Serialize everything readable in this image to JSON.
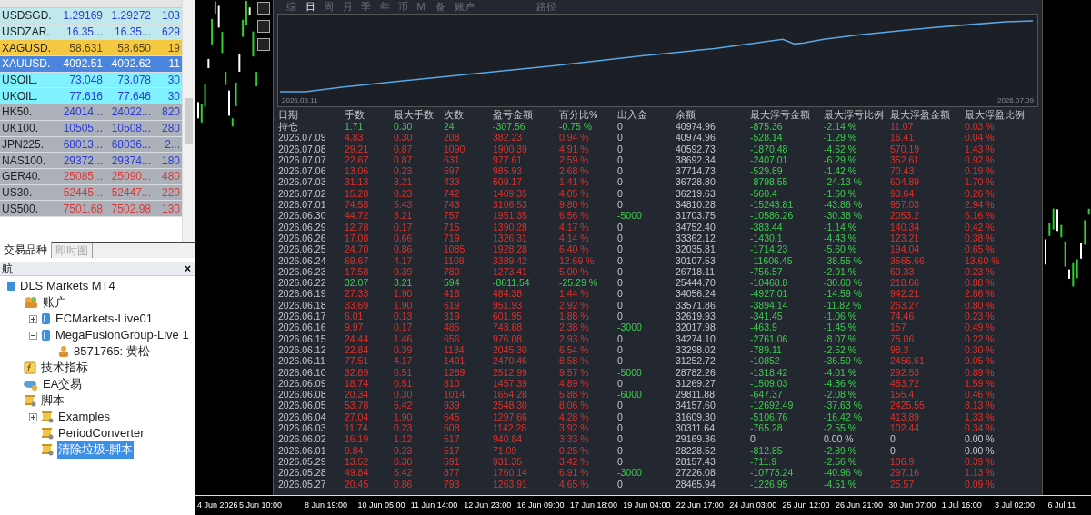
{
  "market_watch": {
    "rows": [
      {
        "symbol": "USDSGD.",
        "bid": "1.29169",
        "ask": "1.29272",
        "spread": "103",
        "color": "#bfe9ec",
        "kind": "up",
        "selected": false
      },
      {
        "symbol": "USDZAR.",
        "bid": "16.35...",
        "ask": "16.35...",
        "spread": "629",
        "color": "#bfe9ec",
        "kind": "up",
        "selected": false
      },
      {
        "symbol": "XAGUSD.",
        "bid": "58.631",
        "ask": "58.650",
        "spread": "19",
        "color": "#f5c842",
        "kind": "flat",
        "selected": false
      },
      {
        "symbol": "XAUUSD.",
        "bid": "4092.51",
        "ask": "4092.62",
        "spread": "11",
        "color": "#4a86e0",
        "kind": "up",
        "selected": true
      },
      {
        "symbol": "USOIL.",
        "bid": "73.048",
        "ask": "73.078",
        "spread": "30",
        "color": "#80f2ff",
        "kind": "up",
        "selected": false
      },
      {
        "symbol": "UKOIL.",
        "bid": "77.616",
        "ask": "77.646",
        "spread": "30",
        "color": "#80f2ff",
        "kind": "up",
        "selected": false
      },
      {
        "symbol": "HK50.",
        "bid": "24014...",
        "ask": "24022...",
        "spread": "820",
        "color": "#acb1b9",
        "kind": "up",
        "selected": false
      },
      {
        "symbol": "UK100.",
        "bid": "10505...",
        "ask": "10508...",
        "spread": "280",
        "color": "#acb1b9",
        "kind": "up",
        "selected": false
      },
      {
        "symbol": "JPN225.",
        "bid": "68013...",
        "ask": "68036...",
        "spread": "2...",
        "color": "#acb1b9",
        "kind": "up",
        "selected": false
      },
      {
        "symbol": "NAS100.",
        "bid": "29372...",
        "ask": "29374...",
        "spread": "180",
        "color": "#acb1b9",
        "kind": "up",
        "selected": false
      },
      {
        "symbol": "GER40.",
        "bid": "25085...",
        "ask": "25090...",
        "spread": "480",
        "color": "#acb1b9",
        "kind": "down",
        "selected": false
      },
      {
        "symbol": "US30.",
        "bid": "52445...",
        "ask": "52447...",
        "spread": "220",
        "color": "#acb1b9",
        "kind": "down",
        "selected": false
      },
      {
        "symbol": "US500.",
        "bid": "7501.68",
        "ask": "7502.98",
        "spread": "130",
        "color": "#acb1b9",
        "kind": "down",
        "selected": false
      }
    ],
    "tabs": [
      {
        "label": "交易品种",
        "selected": true
      },
      {
        "label": "即时图",
        "selected": false
      }
    ]
  },
  "navigator": {
    "title": "航",
    "close": "×",
    "tree": [
      {
        "label": "DLS Markets MT4",
        "kind": "root",
        "selected": false,
        "children": [
          {
            "label": "账户",
            "kind": "accounts",
            "selected": false,
            "children": [
              {
                "label": "ECMarkets-Live01",
                "kind": "server",
                "selected": false,
                "expanded": false
              },
              {
                "label": "MegaFusionGroup-Live 1",
                "kind": "server",
                "selected": false,
                "expanded": true,
                "children": [
                  {
                    "label": "8571765: 黄松",
                    "kind": "user",
                    "selected": false
                  }
                ]
              }
            ]
          },
          {
            "label": "技术指标",
            "kind": "indicators",
            "selected": false
          },
          {
            "label": "EA交易",
            "kind": "experts",
            "selected": false
          },
          {
            "label": "脚本",
            "kind": "scripts",
            "selected": false,
            "children": [
              {
                "label": "Examples",
                "kind": "scripts",
                "selected": false,
                "expanded": false
              },
              {
                "label": "PeriodConverter",
                "kind": "scripts",
                "selected": false
              },
              {
                "label": "清除垃圾-脚本",
                "kind": "scripts",
                "selected": true
              }
            ]
          }
        ]
      }
    ]
  },
  "report": {
    "tabs": [
      {
        "label": "综",
        "selected": false
      },
      {
        "label": "日",
        "selected": true
      },
      {
        "label": "周",
        "selected": false
      },
      {
        "label": "月",
        "selected": false
      },
      {
        "label": "季",
        "selected": false
      },
      {
        "label": "年",
        "selected": false
      },
      {
        "label": "币",
        "selected": false
      },
      {
        "label": "M",
        "selected": false
      },
      {
        "label": "备",
        "selected": false
      },
      {
        "label": "账户",
        "selected": false
      },
      {
        "label": "路径",
        "selected": false
      }
    ],
    "equity_chart": {
      "start_label": "2026.05.11",
      "end_label": "2026.07.09"
    },
    "columns": [
      "日期",
      "手数",
      "最大手数",
      "次数",
      "盈亏金额",
      "百分比%",
      "出入金",
      "余额",
      "最大浮亏金额",
      "最大浮亏比例",
      "最大浮盈金额",
      "最大浮盈比例"
    ],
    "rows": [
      {
        "cells": [
          "持仓",
          "1.71",
          "0.30",
          "24",
          "-307.56",
          "-0.75 %",
          "0",
          "40974.96",
          "-875.36",
          "-2.14 %",
          "11.07",
          "0.03 %"
        ],
        "loss": true,
        "cash_moved": false,
        "drawdown": true,
        "float_gain": true
      },
      {
        "cells": [
          "2026.07.09",
          "4.83",
          "0.30",
          "208",
          "382.23",
          "0.94 %",
          "0",
          "40974.96",
          "-528.14",
          "-1.29 %",
          "16.41",
          "0.04 %"
        ],
        "loss": false,
        "cash_moved": false,
        "drawdown": true,
        "float_gain": true
      },
      {
        "cells": [
          "2026.07.08",
          "29.21",
          "0.87",
          "1090",
          "1900.39",
          "4.91 %",
          "0",
          "40592.73",
          "-1870.48",
          "-4.62 %",
          "570.19",
          "1.43 %"
        ],
        "loss": false,
        "cash_moved": false,
        "drawdown": true,
        "float_gain": true
      },
      {
        "cells": [
          "2026.07.07",
          "22.67",
          "0.87",
          "631",
          "977.61",
          "2.59 %",
          "0",
          "38692.34",
          "-2407.01",
          "-6.29 %",
          "352.61",
          "0.92 %"
        ],
        "loss": false,
        "cash_moved": false,
        "drawdown": true,
        "float_gain": true
      },
      {
        "cells": [
          "2026.07.06",
          "13.06",
          "0.23",
          "597",
          "985.93",
          "2.68 %",
          "0",
          "37714.73",
          "-529.89",
          "-1.42 %",
          "70.43",
          "0.19 %"
        ],
        "loss": false,
        "cash_moved": false,
        "drawdown": true,
        "float_gain": true
      },
      {
        "cells": [
          "2026.07.03",
          "31.13",
          "3.21",
          "433",
          "509.17",
          "1.41 %",
          "0",
          "36728.80",
          "-8798.55",
          "-24.13 %",
          "604.89",
          "1.70 %"
        ],
        "loss": false,
        "cash_moved": false,
        "drawdown": true,
        "float_gain": true
      },
      {
        "cells": [
          "2026.07.02",
          "15.28",
          "0.23",
          "742",
          "1409.35",
          "4.05 %",
          "0",
          "36219.63",
          "-560.4",
          "-1.60 %",
          "93.64",
          "0.26 %"
        ],
        "loss": false,
        "cash_moved": false,
        "drawdown": true,
        "float_gain": true
      },
      {
        "cells": [
          "2026.07.01",
          "74.58",
          "5.43",
          "743",
          "3106.53",
          "9.80 %",
          "0",
          "34810.28",
          "-15243.81",
          "-43.86 %",
          "957.03",
          "2.94 %"
        ],
        "loss": false,
        "cash_moved": false,
        "drawdown": true,
        "float_gain": true
      },
      {
        "cells": [
          "2026.06.30",
          "44.72",
          "3.21",
          "757",
          "1951.35",
          "6.56 %",
          "-5000",
          "31703.75",
          "-10586.26",
          "-30.38 %",
          "2053.2",
          "6.16 %"
        ],
        "loss": false,
        "cash_moved": true,
        "drawdown": true,
        "float_gain": true
      },
      {
        "cells": [
          "2026.06.29",
          "12.78",
          "0.17",
          "715",
          "1390.28",
          "4.17 %",
          "0",
          "34752.40",
          "-383.44",
          "-1.14 %",
          "140.34",
          "0.42 %"
        ],
        "loss": false,
        "cash_moved": false,
        "drawdown": true,
        "float_gain": true
      },
      {
        "cells": [
          "2026.06.26",
          "17.08",
          "0.66",
          "719",
          "1326.31",
          "4.14 %",
          "0",
          "33362.12",
          "-1430.1",
          "-4.43 %",
          "123.21",
          "0.38 %"
        ],
        "loss": false,
        "cash_moved": false,
        "drawdown": true,
        "float_gain": true
      },
      {
        "cells": [
          "2026.06.25",
          "24.70",
          "0.86",
          "1085",
          "1928.28",
          "6.40 %",
          "0",
          "32035.81",
          "-1714.23",
          "-5.60 %",
          "194.04",
          "0.65 %"
        ],
        "loss": false,
        "cash_moved": false,
        "drawdown": true,
        "float_gain": true
      },
      {
        "cells": [
          "2026.06.24",
          "69.67",
          "4.17",
          "1108",
          "3389.42",
          "12.69 %",
          "0",
          "30107.53",
          "-11606.45",
          "-38.55 %",
          "3565.66",
          "13.60 %"
        ],
        "loss": false,
        "cash_moved": false,
        "drawdown": true,
        "float_gain": true
      },
      {
        "cells": [
          "2026.06.23",
          "17.58",
          "0.39",
          "780",
          "1273.41",
          "5.00 %",
          "0",
          "26718.11",
          "-756.57",
          "-2.91 %",
          "60.33",
          "0.23 %"
        ],
        "loss": false,
        "cash_moved": false,
        "drawdown": true,
        "float_gain": true
      },
      {
        "cells": [
          "2026.06.22",
          "32.07",
          "3.21",
          "594",
          "-8611.54",
          "-25.29 %",
          "0",
          "25444.70",
          "-10468.8",
          "-30.60 %",
          "218.66",
          "0.88 %"
        ],
        "loss": true,
        "cash_moved": false,
        "drawdown": true,
        "float_gain": true
      },
      {
        "cells": [
          "2026.06.19",
          "27.33",
          "1.90",
          "418",
          "484.38",
          "1.44 %",
          "0",
          "34056.24",
          "-4927.01",
          "-14.59 %",
          "942.21",
          "2.86 %"
        ],
        "loss": false,
        "cash_moved": false,
        "drawdown": true,
        "float_gain": true
      },
      {
        "cells": [
          "2026.06.18",
          "33.69",
          "1.90",
          "619",
          "951.93",
          "2.92 %",
          "0",
          "33571.86",
          "-3894.14",
          "-11.82 %",
          "263.27",
          "0.80 %"
        ],
        "loss": false,
        "cash_moved": false,
        "drawdown": true,
        "float_gain": true
      },
      {
        "cells": [
          "2026.06.17",
          "6.01",
          "0.13",
          "319",
          "601.95",
          "1.88 %",
          "0",
          "32619.93",
          "-341.45",
          "-1.06 %",
          "74.46",
          "0.23 %"
        ],
        "loss": false,
        "cash_moved": false,
        "drawdown": true,
        "float_gain": true
      },
      {
        "cells": [
          "2026.06.16",
          "9.97",
          "0.17",
          "485",
          "743.88",
          "2.38 %",
          "-3000",
          "32017.98",
          "-463.9",
          "-1.45 %",
          "157",
          "0.49 %"
        ],
        "loss": false,
        "cash_moved": true,
        "drawdown": true,
        "float_gain": true
      },
      {
        "cells": [
          "2026.06.15",
          "24.44",
          "1.46",
          "656",
          "976.08",
          "2.93 %",
          "0",
          "34274.10",
          "-2761.06",
          "-8.07 %",
          "75.06",
          "0.22 %"
        ],
        "loss": false,
        "cash_moved": false,
        "drawdown": true,
        "float_gain": true
      },
      {
        "cells": [
          "2026.06.12",
          "22.84",
          "0.39",
          "1134",
          "2045.30",
          "6.54 %",
          "0",
          "33298.02",
          "-789.11",
          "-2.52 %",
          "98.3",
          "0.30 %"
        ],
        "loss": false,
        "cash_moved": false,
        "drawdown": true,
        "float_gain": true
      },
      {
        "cells": [
          "2026.06.11",
          "77.51",
          "4.17",
          "1491",
          "2470.46",
          "8.58 %",
          "0",
          "31252.72",
          "-10852",
          "-36.59 %",
          "2456.61",
          "9.05 %"
        ],
        "loss": false,
        "cash_moved": false,
        "drawdown": true,
        "float_gain": true
      },
      {
        "cells": [
          "2026.06.10",
          "32.89",
          "0.51",
          "1289",
          "2512.99",
          "9.57 %",
          "-5000",
          "28782.26",
          "-1318.42",
          "-4.01 %",
          "292.53",
          "0.89 %"
        ],
        "loss": false,
        "cash_moved": true,
        "drawdown": true,
        "float_gain": true
      },
      {
        "cells": [
          "2026.06.09",
          "18.74",
          "0.51",
          "810",
          "1457.39",
          "4.89 %",
          "0",
          "31269.27",
          "-1509.03",
          "-4.86 %",
          "483.72",
          "1.59 %"
        ],
        "loss": false,
        "cash_moved": false,
        "drawdown": true,
        "float_gain": true
      },
      {
        "cells": [
          "2026.06.08",
          "20.34",
          "0.30",
          "1014",
          "1654.28",
          "5.88 %",
          "-6000",
          "29811.88",
          "-647.37",
          "-2.08 %",
          "155.4",
          "0.46 %"
        ],
        "loss": false,
        "cash_moved": true,
        "drawdown": true,
        "float_gain": true
      },
      {
        "cells": [
          "2026.06.05",
          "53.78",
          "5.42",
          "939",
          "2548.30",
          "8.06 %",
          "0",
          "34157.60",
          "-12692.49",
          "-37.63 %",
          "2425.55",
          "8.13 %"
        ],
        "loss": false,
        "cash_moved": false,
        "drawdown": true,
        "float_gain": true
      },
      {
        "cells": [
          "2026.06.04",
          "27.04",
          "1.90",
          "645",
          "1297.66",
          "4.28 %",
          "0",
          "31609.30",
          "-5106.76",
          "-16.42 %",
          "413.89",
          "1.33 %"
        ],
        "loss": false,
        "cash_moved": false,
        "drawdown": true,
        "float_gain": true
      },
      {
        "cells": [
          "2026.06.03",
          "11.74",
          "0.23",
          "608",
          "1142.28",
          "3.92 %",
          "0",
          "30311.64",
          "-765.28",
          "-2.55 %",
          "102.44",
          "0.34 %"
        ],
        "loss": false,
        "cash_moved": false,
        "drawdown": true,
        "float_gain": true
      },
      {
        "cells": [
          "2026.06.02",
          "16.19",
          "1.12",
          "517",
          "940.84",
          "3.33 %",
          "0",
          "29169.36",
          "0",
          "0.00 %",
          "0",
          "0.00 %"
        ],
        "loss": false,
        "cash_moved": false,
        "drawdown": false,
        "float_gain": false
      },
      {
        "cells": [
          "2026.06.01",
          "9.84",
          "0.23",
          "517",
          "71.09",
          "0.25 %",
          "0",
          "28228.52",
          "-812.85",
          "-2.89 %",
          "0",
          "0.00 %"
        ],
        "loss": false,
        "cash_moved": false,
        "drawdown": true,
        "float_gain": false
      },
      {
        "cells": [
          "2026.05.29",
          "13.52",
          "0.30",
          "591",
          "931.35",
          "3.42 %",
          "0",
          "28157.43",
          "-711.9",
          "-2.56 %",
          "106.9",
          "0.39 %"
        ],
        "loss": false,
        "cash_moved": false,
        "drawdown": true,
        "float_gain": true
      },
      {
        "cells": [
          "2026.05.28",
          "49.84",
          "5.42",
          "877",
          "1760.14",
          "6.91 %",
          "-3000",
          "27226.08",
          "-10773.24",
          "-40.96 %",
          "297.16",
          "1.13 %"
        ],
        "loss": false,
        "cash_moved": true,
        "drawdown": true,
        "float_gain": true
      },
      {
        "cells": [
          "2026.05.27",
          "20.45",
          "0.86",
          "793",
          "1263.91",
          "4.65 %",
          "0",
          "28465.94",
          "-1226.95",
          "-4.51 %",
          "25.57",
          "0.09 %"
        ],
        "loss": false,
        "cash_moved": false,
        "drawdown": true,
        "float_gain": true
      }
    ]
  },
  "time_axis": [
    "4 Jun 2026",
    "5 Jun 10:00",
    "8 Jun 19:00",
    "10 Jun 05:00",
    "11 Jun 14:00",
    "12 Jun 23:00",
    "16 Jun 09:00",
    "17 Jun 18:00",
    "19 Jun 04:00",
    "22 Jun 17:00",
    "24 Jun 03:00",
    "25 Jun 12:00",
    "26 Jun 21:00",
    "30 Jun 07:00",
    "1 Jul 16:00",
    "3 Jul 02:00",
    "6 Jul 11"
  ]
}
